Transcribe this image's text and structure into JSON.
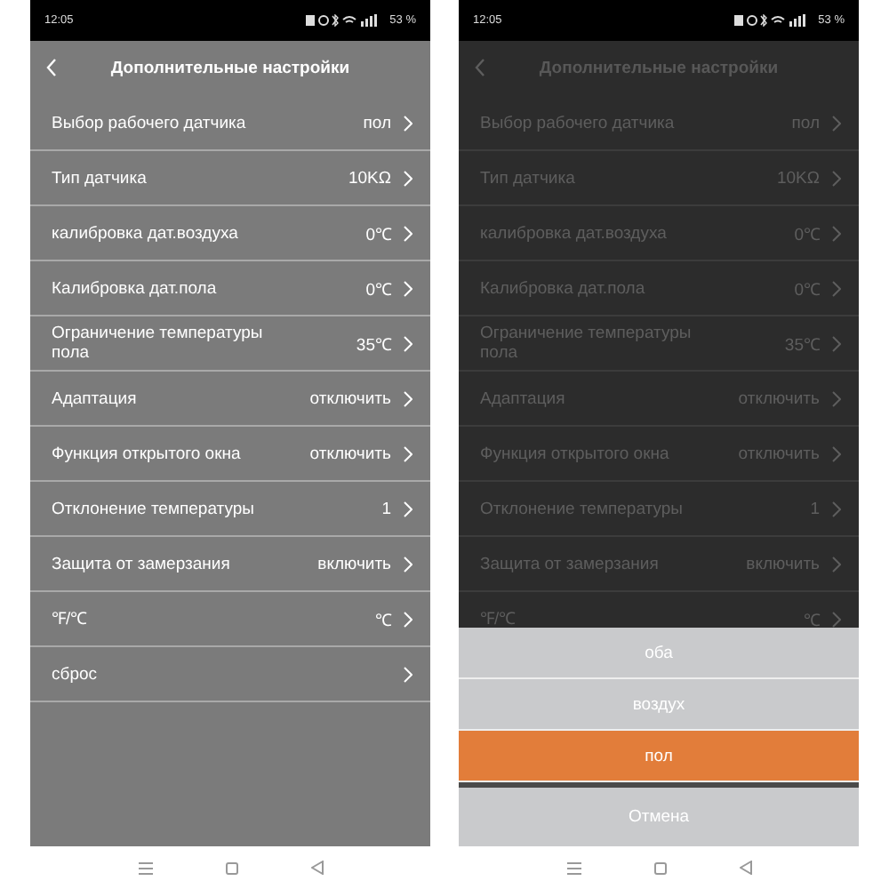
{
  "phones": [
    {
      "dimmed": false,
      "status_bar": {
        "time": "12:05",
        "battery": "53 %"
      },
      "header": {
        "title": "Дополнительные настройки"
      },
      "rows": [
        {
          "label": "Выбор рабочего датчика",
          "value": "пол"
        },
        {
          "label": "Тип датчика",
          "value": "10KΩ"
        },
        {
          "label": "калибровка дат.воздуха",
          "value": "0℃"
        },
        {
          "label": "Калибровка дат.пола",
          "value": "0℃"
        },
        {
          "label": "Ограничение температуры пола",
          "value": "35℃"
        },
        {
          "label": "Адаптация",
          "value": "отключить"
        },
        {
          "label": "Функция открытого окна",
          "value": "отключить"
        },
        {
          "label": "Отклонение температуры",
          "value": "1"
        },
        {
          "label": "Защита от замерзания",
          "value": "включить"
        },
        {
          "label": "℉/℃",
          "value": "℃"
        },
        {
          "label": "сброс"
        }
      ]
    },
    {
      "dimmed": true,
      "status_bar": {
        "time": "12:05",
        "battery": "53 %"
      },
      "header": {
        "title": "Дополнительные настройки"
      },
      "rows": [
        {
          "label": "Выбор рабочего датчика",
          "value": "пол"
        },
        {
          "label": "Тип датчика",
          "value": "10KΩ"
        },
        {
          "label": "калибровка дат.воздуха",
          "value": "0℃"
        },
        {
          "label": "Калибровка дат.пола",
          "value": "0℃"
        },
        {
          "label": "Ограничение температуры пола",
          "value": "35℃"
        },
        {
          "label": "Адаптация",
          "value": "отключить"
        },
        {
          "label": "Функция открытого окна",
          "value": "отключить"
        },
        {
          "label": "Отклонение температуры",
          "value": "1"
        },
        {
          "label": "Защита от замерзания",
          "value": "включить"
        },
        {
          "label": "℉/℃",
          "value": "℃"
        }
      ],
      "action_sheet": {
        "options": [
          {
            "label": "оба",
            "selected": false
          },
          {
            "label": "воздух",
            "selected": false
          },
          {
            "label": "пол",
            "selected": true
          }
        ],
        "cancel": "Отмена"
      }
    }
  ]
}
